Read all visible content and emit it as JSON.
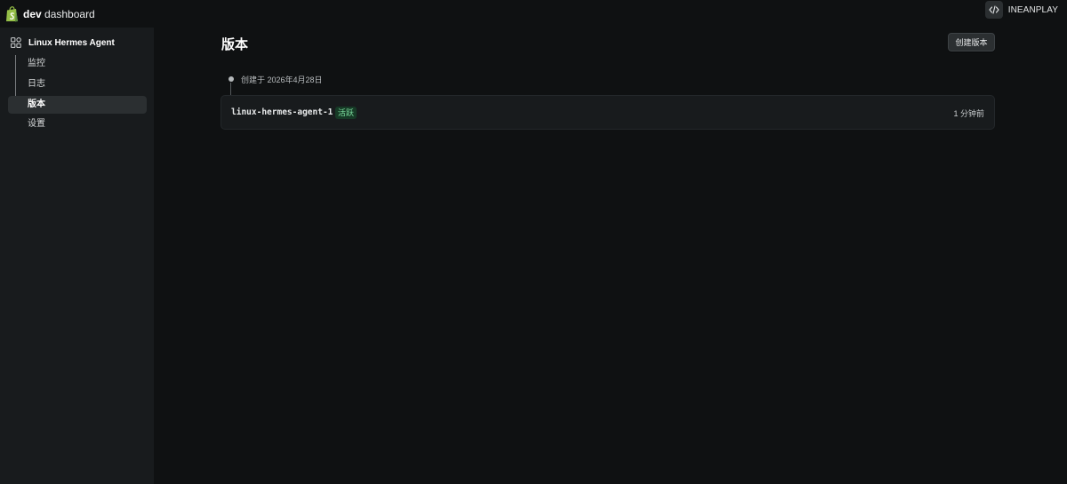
{
  "app": {
    "brand_bold": "dev",
    "brand_rest": " dashboard",
    "logo_icon": "shopify-bag-icon",
    "accent_color": "#95bf47"
  },
  "header": {
    "code_icon": "code-brackets-icon",
    "user_name": "INEANPLAY"
  },
  "sidebar": {
    "project_icon": "apps-grid-icon",
    "project_name": "Linux Hermes Agent",
    "items": [
      {
        "label": "监控",
        "active": false
      },
      {
        "label": "日志",
        "active": false
      },
      {
        "label": "版本",
        "active": true
      },
      {
        "label": "设置",
        "active": false
      }
    ]
  },
  "main": {
    "title": "版本",
    "create_button": "创建版本",
    "timeline_label": "创建于 2026年4月28日",
    "versions": [
      {
        "name": "linux-hermes-agent-1",
        "status": "活跃",
        "status_color": "#7ee0a0",
        "time": "1 分钟前"
      }
    ]
  }
}
